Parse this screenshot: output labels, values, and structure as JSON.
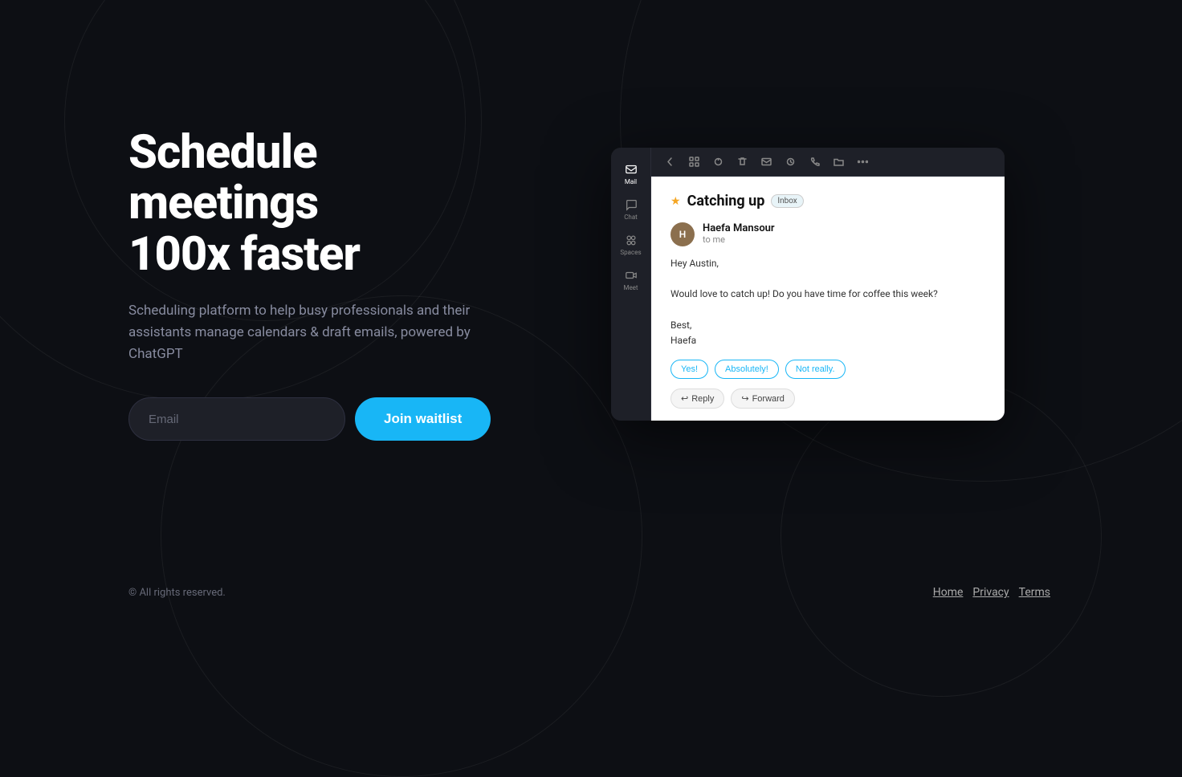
{
  "hero": {
    "title_line1": "Schedule meetings",
    "title_line2": "100x faster",
    "subtitle": "Scheduling platform to help busy professionals and their assistants manage calendars & draft emails, powered by ChatGPT",
    "email_placeholder": "Email",
    "cta_button": "Join waitlist"
  },
  "email_mockup": {
    "subject": "Catching up",
    "badge": "Inbox",
    "sender_name": "Haefa Mansour",
    "sender_to": "to me",
    "greeting": "Hey Austin,",
    "body_line1": "Would love to catch up! Do you have time for coffee this week?",
    "body_line2": "",
    "sign_off": "Best,",
    "sign_name": "Haefa",
    "quick_reply_1": "Yes!",
    "quick_reply_2": "Absolutely!",
    "quick_reply_3": "Not really.",
    "action_reply": "Reply",
    "action_forward": "Forward"
  },
  "sidebar": {
    "items": [
      {
        "label": "Mail",
        "active": true
      },
      {
        "label": "Chat",
        "active": false
      },
      {
        "label": "Spaces",
        "active": false
      },
      {
        "label": "Meet",
        "active": false
      }
    ]
  },
  "footer": {
    "copyright": "© All rights reserved.",
    "links": [
      {
        "label": "Home"
      },
      {
        "label": "Privacy"
      },
      {
        "label": "Terms"
      }
    ]
  },
  "colors": {
    "accent": "#18b6f6",
    "background": "#0d0f14"
  }
}
